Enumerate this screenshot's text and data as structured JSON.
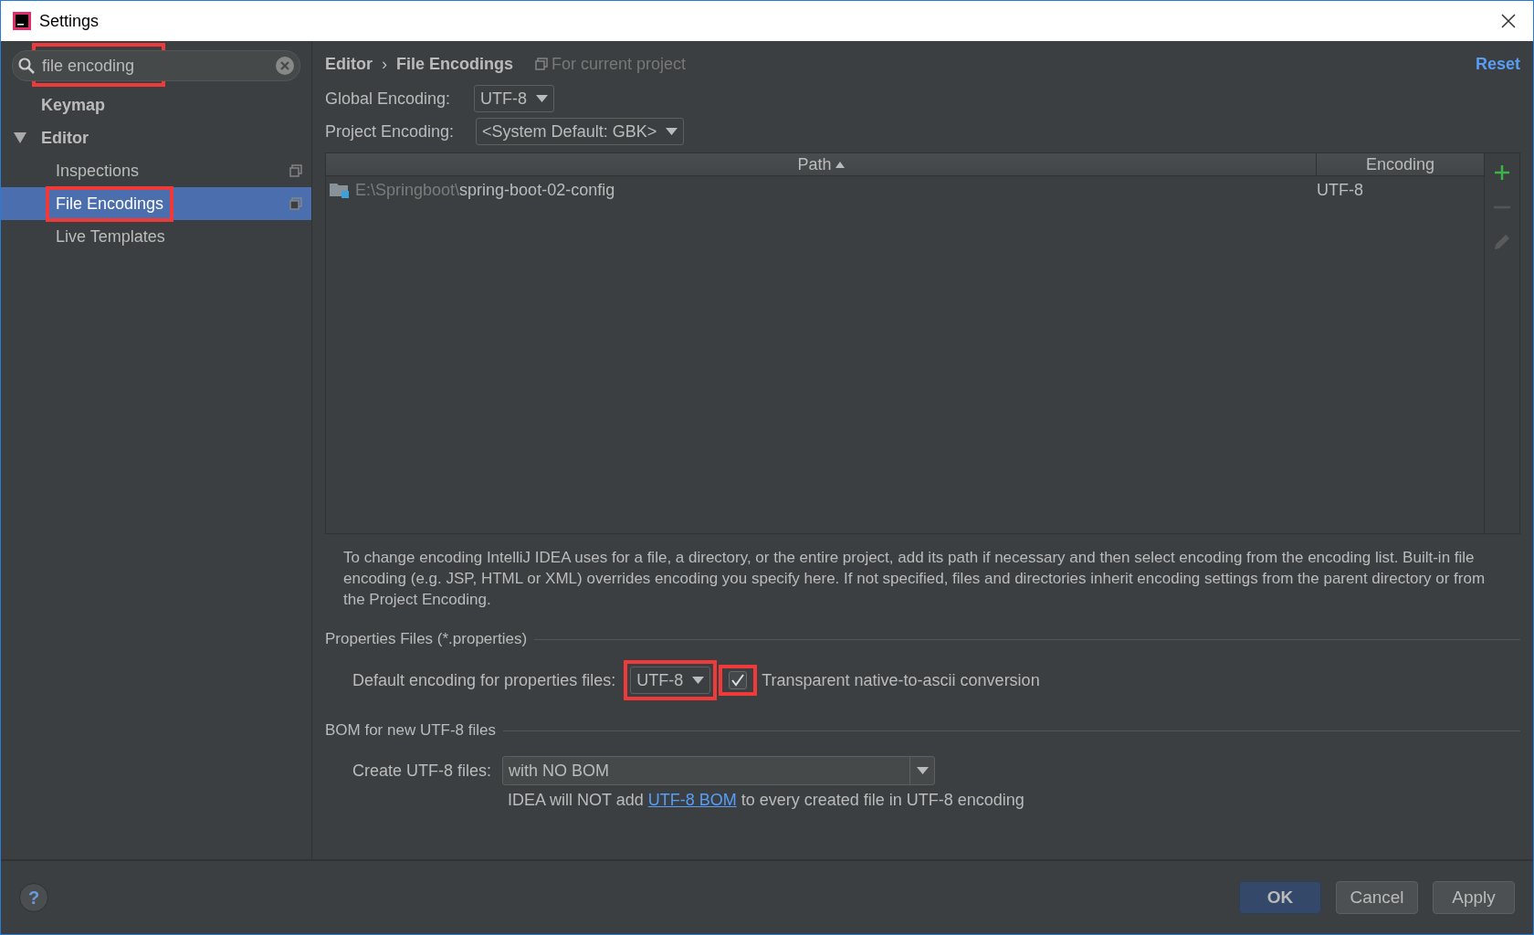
{
  "window": {
    "title": "Settings"
  },
  "search": {
    "value": "file encoding",
    "annotated": true
  },
  "sidebar": {
    "items": [
      {
        "label": "Keymap",
        "bold": true,
        "selected": false,
        "project_icon": false
      },
      {
        "label": "Editor",
        "bold": true,
        "selected": false,
        "project_icon": false,
        "expanded": true,
        "children": [
          {
            "label": "Inspections",
            "bold": false,
            "selected": false,
            "project_icon": true
          },
          {
            "label": "File Encodings",
            "bold": false,
            "selected": true,
            "annotated": true,
            "project_icon": true
          },
          {
            "label": "Live Templates",
            "bold": false,
            "selected": false,
            "project_icon": false
          }
        ]
      }
    ]
  },
  "breadcrumb": {
    "items": [
      "Editor",
      "File Encodings"
    ],
    "separator": "›",
    "scope": "For current project"
  },
  "reset": "Reset",
  "global_encoding": {
    "label": "Global Encoding:",
    "value": "UTF-8"
  },
  "project_encoding": {
    "label": "Project Encoding:",
    "value": "<System Default: GBK>"
  },
  "table": {
    "columns": [
      "Path",
      "Encoding"
    ],
    "rows": [
      {
        "path_prefix": "E:\\Springboot\\",
        "path_name": "spring-boot-02-config",
        "encoding": "UTF-8"
      }
    ]
  },
  "description": "To change encoding IntelliJ IDEA uses for a file, a directory, or the entire project, add its path if necessary and then select encoding from the encoding list. Built-in file encoding (e.g. JSP, HTML or XML) overrides encoding you specify here. If not specified, files and directories inherit encoding settings from the parent directory or from the Project Encoding.",
  "properties": {
    "title": "Properties Files (*.properties)",
    "label": "Default encoding for properties files:",
    "value": "UTF-8",
    "value_annotated": true,
    "checkbox": {
      "label": "Transparent native-to-ascii conversion",
      "checked": true,
      "annotated": true
    }
  },
  "bom": {
    "title": "BOM for new UTF-8 files",
    "label": "Create UTF-8 files:",
    "value": "with NO BOM",
    "note_before": "IDEA will NOT add ",
    "note_link": "UTF-8 BOM",
    "note_after": " to every created file in UTF-8 encoding"
  },
  "help": "?",
  "buttons": [
    {
      "label": "OK",
      "kind": "default"
    },
    {
      "label": "Cancel",
      "kind": "normal"
    },
    {
      "label": "Apply",
      "kind": "normal"
    }
  ]
}
